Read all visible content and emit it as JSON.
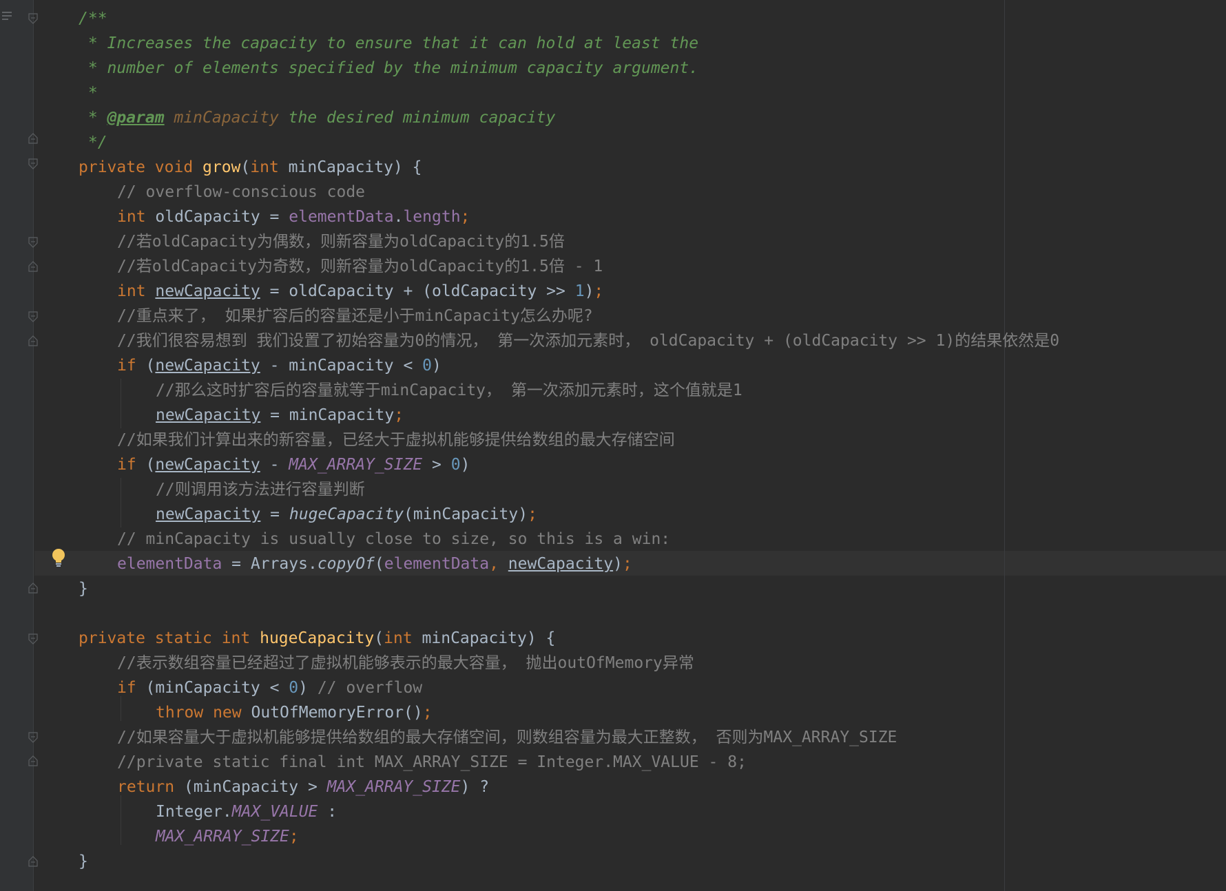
{
  "colors": {
    "background": "#2b2b2b",
    "keyword": "#cc7832",
    "method_decl": "#ffc66d",
    "comment": "#808080",
    "javadoc": "#629755",
    "number": "#6897bb",
    "field": "#9876aa",
    "text": "#a9b7c6"
  },
  "gutter": {
    "menu_icon": "lines-icon",
    "hint_icon": "lightbulb-icon"
  },
  "code": {
    "l1": "/**",
    "l2": " * Increases the capacity to ensure that it can hold at least the",
    "l3": " * number of elements specified by the minimum capacity argument.",
    "l4": " *",
    "l5a": " * ",
    "l5b": "@param",
    "l5c": " minCapacity",
    "l5d": " the desired minimum capacity",
    "l6": " */",
    "l7a": "private void ",
    "l7b": "grow",
    "l7c": "(",
    "l7d": "int",
    "l7e": " minCapacity) {",
    "l8": "// overflow-conscious code",
    "l9a": "int",
    "l9b": " oldCapacity = ",
    "l9c": "elementData",
    "l9d": ".",
    "l9e": "length",
    "l9f": ";",
    "l10": "//若oldCapacity为偶数，则新容量为oldCapacity的1.5倍",
    "l11": "//若oldCapacity为奇数，则新容量为oldCapacity的1.5倍 - 1",
    "l12a": "int",
    "l12b": " ",
    "l12c": "newCapacity",
    "l12d": " = oldCapacity + (oldCapacity >> ",
    "l12e": "1",
    "l12f": ")",
    "l12g": ";",
    "l13": "//重点来了， 如果扩容后的容量还是小于minCapacity怎么办呢?",
    "l14": "//我们很容易想到 我们设置了初始容量为0的情况， 第一次添加元素时， oldCapacity + (oldCapacity >> 1)的结果依然是0",
    "l15a": "if",
    "l15b": " (",
    "l15c": "newCapacity",
    "l15d": " - minCapacity < ",
    "l15e": "0",
    "l15f": ")",
    "l16": "//那么这时扩容后的容量就等于minCapacity， 第一次添加元素时，这个值就是1",
    "l17a": "newCapacity",
    "l17b": " = minCapacity",
    "l17c": ";",
    "l18": "//如果我们计算出来的新容量，已经大于虚拟机能够提供给数组的最大存储空间",
    "l19a": "if",
    "l19b": " (",
    "l19c": "newCapacity",
    "l19d": " - ",
    "l19e": "MAX_ARRAY_SIZE",
    "l19f": " > ",
    "l19g": "0",
    "l19h": ")",
    "l20": "//则调用该方法进行容量判断",
    "l21a": "newCapacity",
    "l21b": " = ",
    "l21c": "hugeCapacity",
    "l21d": "(minCapacity)",
    "l21e": ";",
    "l22": "// minCapacity is usually close to size, so this is a win:",
    "l23a": "elementData",
    "l23b": " = Arrays.",
    "l23c": "copyOf",
    "l23d": "(",
    "l23e": "elementData",
    "l23f": ", ",
    "l23g": "newCapacity",
    "l23h": ")",
    "l23i": ";",
    "l24": "}",
    "l26a": "private static int ",
    "l26b": "hugeCapacity",
    "l26c": "(",
    "l26d": "int",
    "l26e": " minCapacity) {",
    "l27": "//表示数组容量已经超过了虚拟机能够表示的最大容量， 抛出outOfMemory异常",
    "l28a": "if",
    "l28b": " (minCapacity < ",
    "l28c": "0",
    "l28d": ") ",
    "l28e": "// overflow",
    "l29a": "throw new ",
    "l29b": "OutOfMemoryError()",
    "l29c": ";",
    "l30": "//如果容量大于虚拟机能够提供给数组的最大存储空间，则数组容量为最大正整数， 否则为MAX_ARRAY_SIZE",
    "l31": "//private static final int MAX_ARRAY_SIZE = Integer.MAX_VALUE - 8;",
    "l32a": "return",
    "l32b": " (minCapacity > ",
    "l32c": "MAX_ARRAY_SIZE",
    "l32d": ") ?",
    "l33a": "Integer.",
    "l33b": "MAX_VALUE",
    "l33c": " :",
    "l34a": "MAX_ARRAY_SIZE",
    "l34b": ";",
    "l35": "}"
  }
}
